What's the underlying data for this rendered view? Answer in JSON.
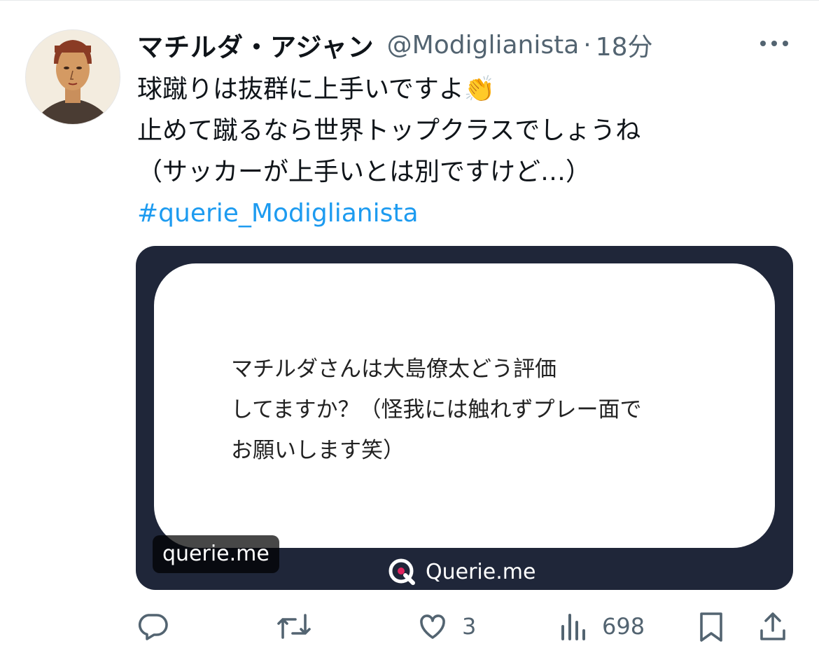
{
  "post": {
    "display_name": "マチルダ・アジャン",
    "handle": "@Modiglianista",
    "separator": "·",
    "time": "18分",
    "text_lines": [
      "球蹴りは抜群に上手いですよ👏",
      "止めて蹴るなら世界トップクラスでしょうね",
      "（サッカーが上手いとは別ですけど…）"
    ],
    "hashtag": "#querie_Modiglianista"
  },
  "card": {
    "question_lines": [
      "マチルダさんは大島僚太どう評価",
      "してますか？（怪我には触れずプレー面で",
      "お願いします笑）"
    ],
    "domain_badge": "querie.me",
    "brand": "Querie.me"
  },
  "actions": {
    "likes": "3",
    "views": "698"
  },
  "colors": {
    "link": "#1d9bf0",
    "muted": "#536471",
    "card_bg": "#1f2639"
  },
  "icons": [
    "more-icon",
    "reply-icon",
    "retweet-icon",
    "like-icon",
    "views-icon",
    "bookmark-icon",
    "share-icon",
    "querie-logo-icon"
  ]
}
